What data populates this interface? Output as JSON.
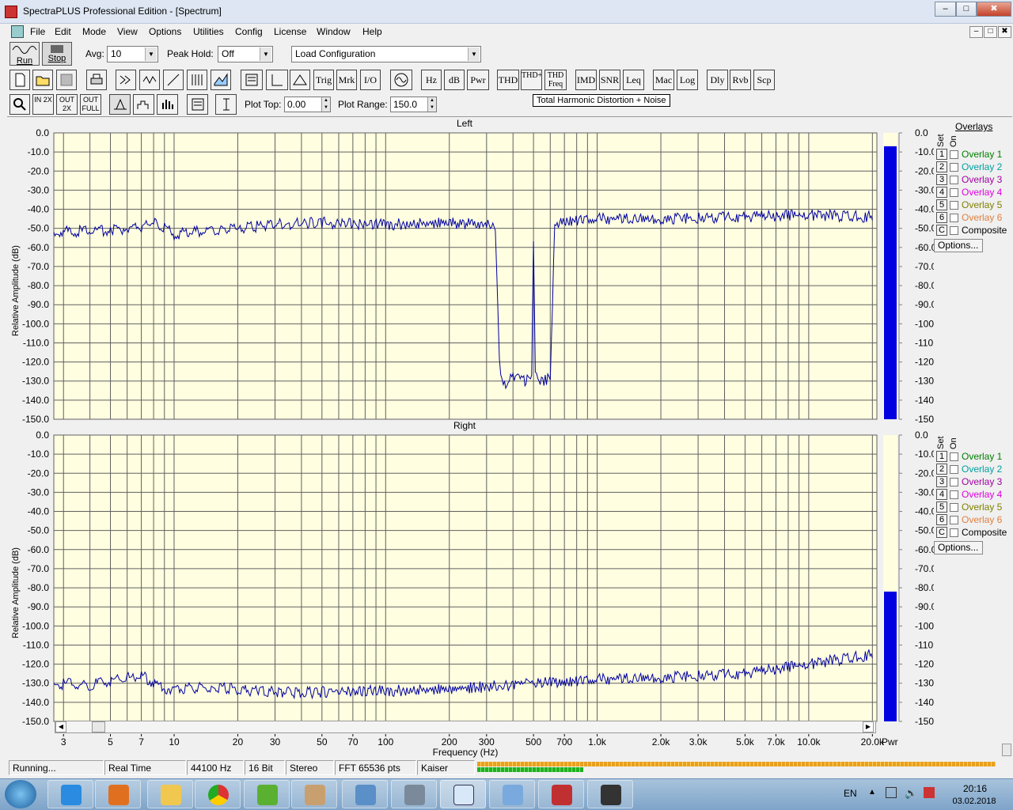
{
  "window": {
    "title": "SpectraPLUS Professional Edition - [Spectrum]",
    "min": "‒",
    "max": "□",
    "close": "✖"
  },
  "menu": [
    "File",
    "Edit",
    "Mode",
    "View",
    "Options",
    "Utilities",
    "Config",
    "License",
    "Window",
    "Help"
  ],
  "toolbar1": {
    "run": "Run",
    "stop": "Stop",
    "avg_label": "Avg:",
    "avg_value": "10",
    "peak_label": "Peak Hold:",
    "peak_value": "Off",
    "config_value": "Load Configuration"
  },
  "toolbar2": [
    "Trig",
    "Mrk",
    "I/O",
    "Hz",
    "dB",
    "Pwr",
    "THD",
    "THD+N",
    "THD Freq",
    "IMD",
    "SNR",
    "Leq",
    "Mac",
    "Log",
    "Dly",
    "Rvb",
    "Scp"
  ],
  "toolbar3": {
    "zoom_in": "IN 2X",
    "zoom_out": "OUT 2X",
    "zoom_full": "OUT FULL",
    "plot_top_label": "Plot Top:",
    "plot_top_value": "0.00",
    "plot_range_label": "Plot Range:",
    "plot_range_value": "150.0"
  },
  "tooltip": "Total Harmonic Distortion + Noise",
  "overlays": {
    "title": "Overlays",
    "set": "Set",
    "on": "On",
    "options": "Options...",
    "items": [
      {
        "n": "1",
        "label": "Overlay 1",
        "color": "#008000"
      },
      {
        "n": "2",
        "label": "Overlay 2",
        "color": "#00a0a0"
      },
      {
        "n": "3",
        "label": "Overlay 3",
        "color": "#a000a0"
      },
      {
        "n": "4",
        "label": "Overlay 4",
        "color": "#e000e0"
      },
      {
        "n": "5",
        "label": "Overlay 5",
        "color": "#808000"
      },
      {
        "n": "6",
        "label": "Overlay 6",
        "color": "#e08040"
      },
      {
        "n": "C",
        "label": "Composite",
        "color": "#000000"
      }
    ]
  },
  "chart_data": [
    {
      "type": "line",
      "title": "Left",
      "ylabel": "Relative Amplitude (dB)",
      "xlabel": "Frequency (Hz)",
      "x_scale": "log",
      "xlim": [
        2.7,
        21000
      ],
      "ylim": [
        -150,
        0
      ],
      "yticks": [
        "0.0",
        "-10.0",
        "-20.0",
        "-30.0",
        "-40.0",
        "-50.0",
        "-60.0",
        "-70.0",
        "-80.0",
        "-90.0",
        "-100.0",
        "-110.0",
        "-120.0",
        "-130.0",
        "-140.0",
        "-150.0"
      ],
      "series": [
        {
          "color": "#0000a0",
          "points": [
            [
              2.7,
              -52
            ],
            [
              5,
              -51
            ],
            [
              7,
              -49
            ],
            [
              8,
              -46
            ],
            [
              10,
              -53
            ],
            [
              15,
              -51
            ],
            [
              20,
              -50
            ],
            [
              30,
              -48
            ],
            [
              50,
              -47
            ],
            [
              100,
              -48
            ],
            [
              200,
              -47
            ],
            [
              300,
              -48
            ],
            [
              330,
              -50
            ],
            [
              345,
              -120
            ],
            [
              360,
              -132
            ],
            [
              400,
              -128
            ],
            [
              450,
              -130
            ],
            [
              490,
              -129
            ],
            [
              500,
              -55
            ],
            [
              510,
              -128
            ],
            [
              560,
              -130
            ],
            [
              600,
              -128
            ],
            [
              630,
              -48
            ],
            [
              700,
              -46
            ],
            [
              1000,
              -45
            ],
            [
              2000,
              -45
            ],
            [
              5000,
              -44
            ],
            [
              10000,
              -43
            ],
            [
              20000,
              -44
            ]
          ]
        }
      ],
      "meter": {
        "label": "Pwr",
        "level_db": -7,
        "scale": [
          "0.0",
          "-10.0",
          "-20.0",
          "-30.0",
          "-40.0",
          "-50.0",
          "-60.0",
          "-70.0",
          "-80.0",
          "-90.0",
          "-100.0",
          "-110.0",
          "-120.0",
          "-130.0",
          "-140.0",
          "-150.0"
        ]
      }
    },
    {
      "type": "line",
      "title": "Right",
      "ylabel": "Relative Amplitude (dB)",
      "xlabel": "Frequency (Hz)",
      "x_scale": "log",
      "xlim": [
        2.7,
        21000
      ],
      "ylim": [
        -150,
        0
      ],
      "yticks": [
        "0.0",
        "-10.0",
        "-20.0",
        "-30.0",
        "-40.0",
        "-50.0",
        "-60.0",
        "-70.0",
        "-80.0",
        "-90.0",
        "-100.0",
        "-110.0",
        "-120.0",
        "-130.0",
        "-140.0",
        "-150.0"
      ],
      "series": [
        {
          "color": "#0000a0",
          "points": [
            [
              2.7,
              -130
            ],
            [
              4,
              -131
            ],
            [
              7,
              -126
            ],
            [
              9,
              -133
            ],
            [
              15,
              -132
            ],
            [
              25,
              -134
            ],
            [
              40,
              -135
            ],
            [
              70,
              -134
            ],
            [
              100,
              -134
            ],
            [
              200,
              -133
            ],
            [
              400,
              -131
            ],
            [
              700,
              -129
            ],
            [
              1000,
              -128
            ],
            [
              2000,
              -127
            ],
            [
              5000,
              -125
            ],
            [
              10000,
              -120
            ],
            [
              20000,
              -115
            ]
          ]
        }
      ],
      "meter": {
        "label": "Pwr",
        "level_db": -82,
        "scale": [
          "0.0",
          "-10.0",
          "-20.0",
          "-30.0",
          "-40.0",
          "-50.0",
          "-60.0",
          "-70.0",
          "-80.0",
          "-90.0",
          "-100.0",
          "-110.0",
          "-120.0",
          "-130.0",
          "-140.0",
          "-150.0"
        ]
      }
    }
  ],
  "xticks": [
    {
      "f": 3,
      "l": "3"
    },
    {
      "f": 5,
      "l": "5"
    },
    {
      "f": 7,
      "l": "7"
    },
    {
      "f": 10,
      "l": "10"
    },
    {
      "f": 20,
      "l": "20"
    },
    {
      "f": 30,
      "l": "30"
    },
    {
      "f": 50,
      "l": "50"
    },
    {
      "f": 70,
      "l": "70"
    },
    {
      "f": 100,
      "l": "100"
    },
    {
      "f": 200,
      "l": "200"
    },
    {
      "f": 300,
      "l": "300"
    },
    {
      "f": 500,
      "l": "500"
    },
    {
      "f": 700,
      "l": "700"
    },
    {
      "f": 1000,
      "l": "1.0k"
    },
    {
      "f": 2000,
      "l": "2.0k"
    },
    {
      "f": 3000,
      "l": "3.0k"
    },
    {
      "f": 5000,
      "l": "5.0k"
    },
    {
      "f": 7000,
      "l": "7.0k"
    },
    {
      "f": 10000,
      "l": "10.0k"
    },
    {
      "f": 20000,
      "l": "20.0k"
    }
  ],
  "xaxis_label": "Frequency (Hz)",
  "pwr_label": "Pwr",
  "status": {
    "state": "Running...",
    "mode": "Real Time",
    "rate": "44100 Hz",
    "bits": "16 Bit",
    "channels": "Stereo",
    "fft": "FFT 65536 pts",
    "window": "Kaiser"
  },
  "tray": {
    "lang": "EN",
    "time": "20:16",
    "date": "03.02.2018"
  }
}
